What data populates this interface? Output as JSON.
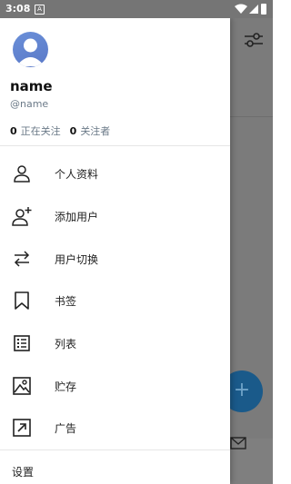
{
  "status_bar": {
    "time": "3:08",
    "notification_badge": "A",
    "icons": [
      "wifi-icon",
      "signal-icon",
      "battery-icon"
    ]
  },
  "profile": {
    "name": "name",
    "handle": "@name",
    "following_count": "0",
    "following_label": "正在关注",
    "followers_count": "0",
    "followers_label": "关注者"
  },
  "menu": {
    "items": [
      {
        "label": "个人资料",
        "icon": "person-icon"
      },
      {
        "label": "添加用户",
        "icon": "add-person-icon"
      },
      {
        "label": "用户切换",
        "icon": "swap-icon"
      },
      {
        "label": "书签",
        "icon": "bookmark-icon"
      },
      {
        "label": "列表",
        "icon": "list-icon"
      },
      {
        "label": "贮存",
        "icon": "image-icon"
      },
      {
        "label": "广告",
        "icon": "arrow-up-right-icon"
      }
    ],
    "settings_label": "设置"
  },
  "background": {
    "fab_symbol": "+"
  },
  "colors": {
    "accent": "#1a5a8a",
    "secondary_text": "#6b7a88",
    "scrim": "#7b7b7b"
  }
}
